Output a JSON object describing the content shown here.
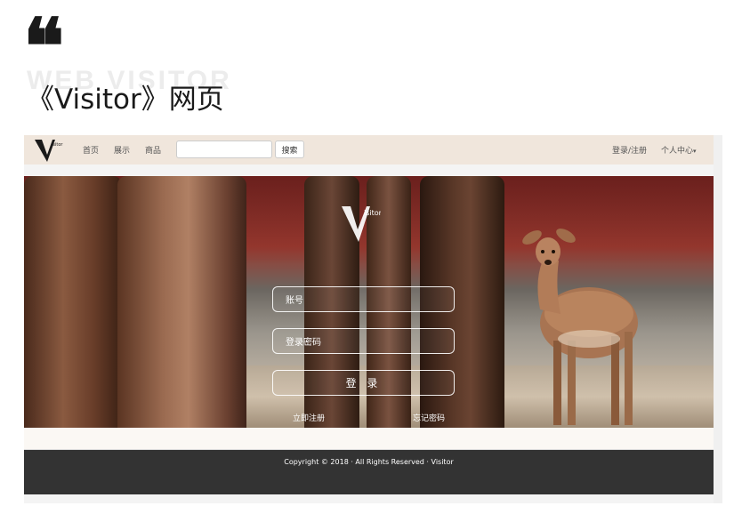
{
  "slide": {
    "quote_mark": "❝",
    "ghost_title": "WEB VISITOR",
    "title": "《Visitor》网页"
  },
  "site": {
    "logo_text": "isitor",
    "nav": [
      {
        "label": "首页"
      },
      {
        "label": "展示"
      },
      {
        "label": "商品"
      }
    ],
    "search": {
      "value": "",
      "button_label": "搜索"
    },
    "right_nav": {
      "login_register": "登录/注册",
      "user_center": "个人中心",
      "user_center_caret": "▾"
    }
  },
  "hero": {
    "logo_text": "isitor",
    "username_placeholder": "账号",
    "password_placeholder": "登录密码",
    "login_button": "登 录",
    "register_link": "立即注册",
    "forgot_link": "忘记密码"
  },
  "footer": {
    "copyright": "Copyright © 2018 · All Rights Reserved · Visitor"
  },
  "colors": {
    "navbar_bg": "#f0e6dc",
    "footer_bg": "#333333",
    "wall_red": "#8a2f2a"
  }
}
